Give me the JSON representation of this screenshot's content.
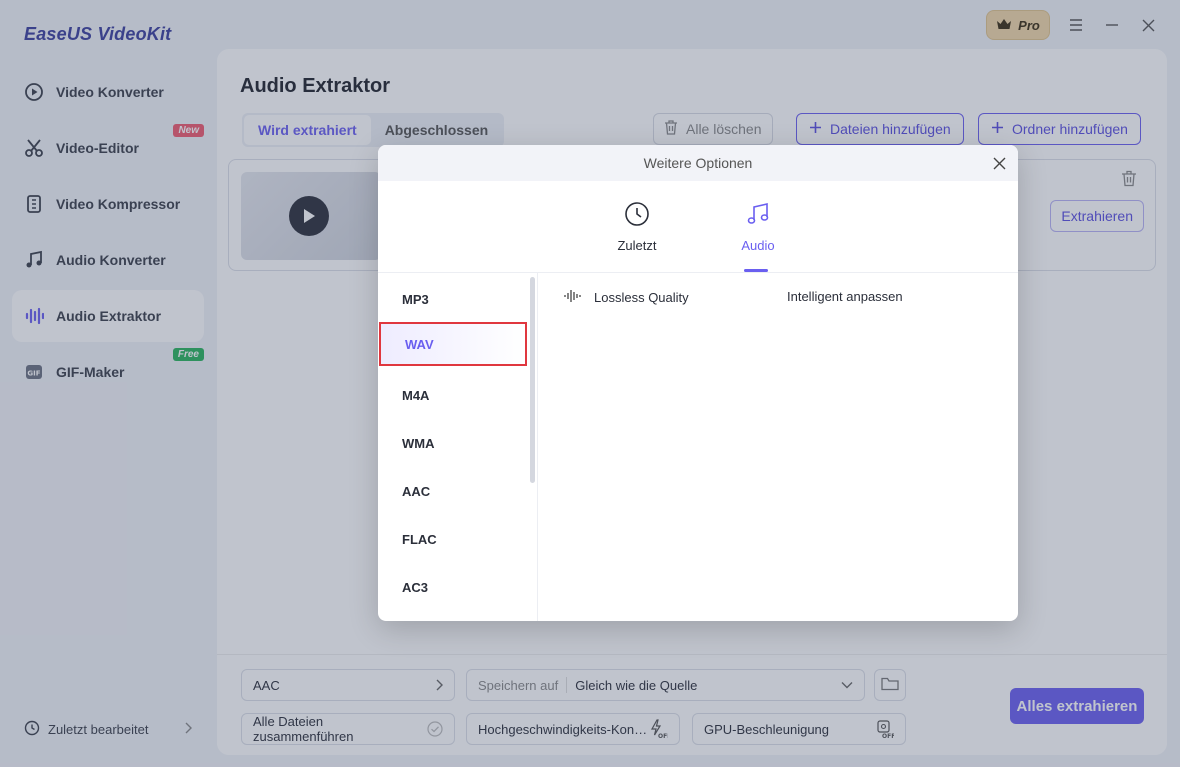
{
  "app": {
    "logo": "EaseUS VideoKit",
    "pro_label": "Pro"
  },
  "sidebar": {
    "items": [
      {
        "label": "Video Konverter",
        "icon": "video-convert-icon"
      },
      {
        "label": "Video-Editor",
        "icon": "scissors-icon",
        "tag": "New"
      },
      {
        "label": "Video Kompressor",
        "icon": "compress-icon"
      },
      {
        "label": "Audio Konverter",
        "icon": "music-note-icon"
      },
      {
        "label": "Audio Extraktor",
        "icon": "waveform-icon",
        "active": true
      },
      {
        "label": "GIF-Maker",
        "icon": "gif-icon",
        "tag": "Free"
      }
    ],
    "recent": "Zuletzt bearbeitet"
  },
  "main": {
    "title": "Audio Extraktor",
    "tabs": [
      "Wird extrahiert",
      "Abgeschlossen"
    ],
    "clear_all": "Alle löschen",
    "add_files": "Dateien hinzufügen",
    "add_folder": "Ordner hinzufügen",
    "extract_button": "Extrahieren"
  },
  "bottom": {
    "format": "AAC",
    "save_label": "Speichern auf",
    "save_value": "Gleich wie die Quelle",
    "merge_label": "Alle Dateien zusammenführen",
    "high_speed_label": "Hochgeschwindigkeits-Kon…",
    "gpu_label": "GPU-Beschleunigung",
    "extract_all": "Alles extrahieren"
  },
  "dialog": {
    "title": "Weitere Optionen",
    "tabs": [
      "Zuletzt",
      "Audio"
    ],
    "formats": [
      "MP3",
      "WAV",
      "M4A",
      "WMA",
      "AAC",
      "FLAC",
      "AC3"
    ],
    "selected_format": "WAV",
    "quality_label": "Lossless Quality",
    "quality_adjust": "Intelligent anpassen"
  },
  "colors": {
    "accent": "#6a5ff0",
    "highlight_border": "#e0373f"
  }
}
